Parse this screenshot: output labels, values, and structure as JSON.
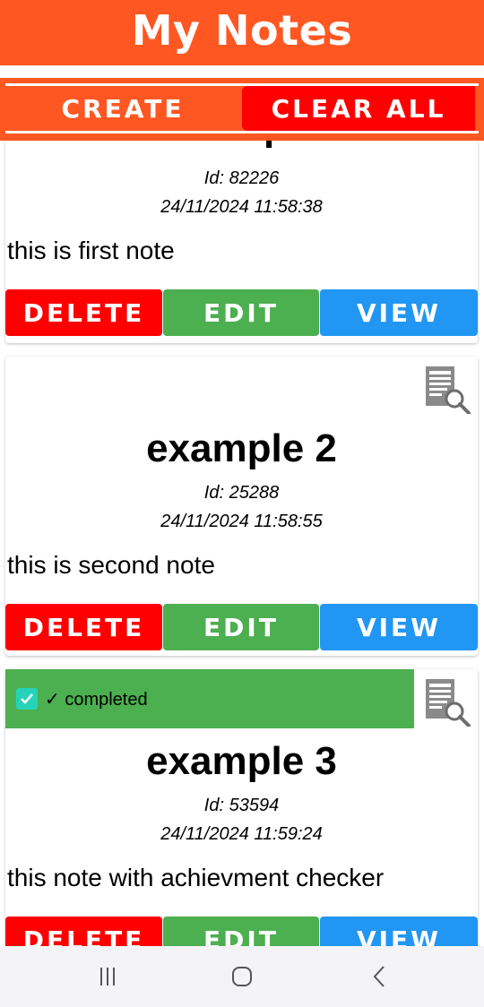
{
  "header": {
    "title": "My Notes"
  },
  "actions": {
    "create_label": "CREATE",
    "clear_all_label": "CLEAR ALL"
  },
  "notes": [
    {
      "title": "example",
      "id_text": "Id: 82226",
      "date": "24/11/2024 11:58:38",
      "body": "this is first note",
      "completed": false
    },
    {
      "title": "example 2",
      "id_text": "Id: 25288",
      "date": "24/11/2024 11:58:55",
      "body": "this is second note",
      "completed": false
    },
    {
      "title": "example 3",
      "id_text": "Id: 53594",
      "date": "24/11/2024 11:59:24",
      "body": "this note with achievment checker",
      "completed": true,
      "completed_label": "✓ completed"
    }
  ],
  "buttons": {
    "delete": "DELETE",
    "edit": "EDIT",
    "view": "VIEW"
  },
  "colors": {
    "header": "#ff5722",
    "clear_all": "#ff0000",
    "delete": "#ff0000",
    "edit": "#4caf50",
    "view": "#2196f3",
    "completed": "#4caf50",
    "checkbox": "#26d3b9"
  },
  "icons": {
    "view_note": "document-search-icon",
    "nav_recent": "recent-apps-icon",
    "nav_home": "home-icon",
    "nav_back": "back-icon"
  }
}
